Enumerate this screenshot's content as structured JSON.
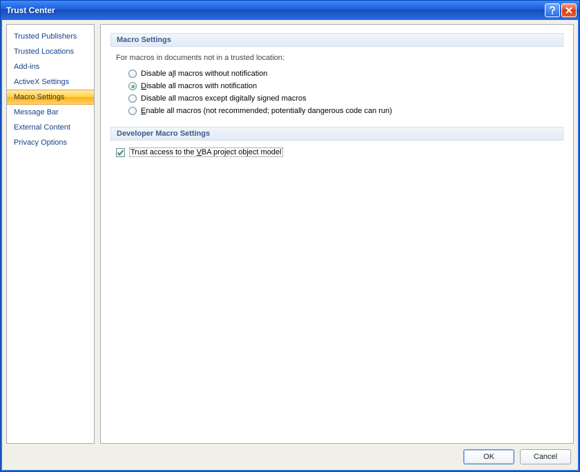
{
  "window": {
    "title": "Trust Center"
  },
  "sidebar": {
    "items": [
      {
        "label": "Trusted Publishers"
      },
      {
        "label": "Trusted Locations"
      },
      {
        "label": "Add-ins"
      },
      {
        "label": "ActiveX Settings"
      },
      {
        "label": "Macro Settings"
      },
      {
        "label": "Message Bar"
      },
      {
        "label": "External Content"
      },
      {
        "label": "Privacy Options"
      }
    ],
    "selected_index": 4
  },
  "sections": {
    "macro": {
      "title": "Macro Settings",
      "note": "For macros in documents not in a trusted location:",
      "options": [
        {
          "pre": "Disable a",
          "u": "l",
          "post": "l macros without notification"
        },
        {
          "pre": "",
          "u": "D",
          "post": "isable all macros with notification"
        },
        {
          "pre": "Disable all macros except di",
          "u": "g",
          "post": "itally signed macros"
        },
        {
          "pre": "",
          "u": "E",
          "post": "nable all macros (not recommended; potentially dangerous code can run)"
        }
      ],
      "selected_index": 1
    },
    "developer": {
      "title": "Developer Macro Settings",
      "trust_vba": {
        "pre": "Trust access to the ",
        "u": "V",
        "post": "BA project object model",
        "checked": true
      }
    }
  },
  "footer": {
    "ok": "OK",
    "cancel": "Cancel"
  }
}
